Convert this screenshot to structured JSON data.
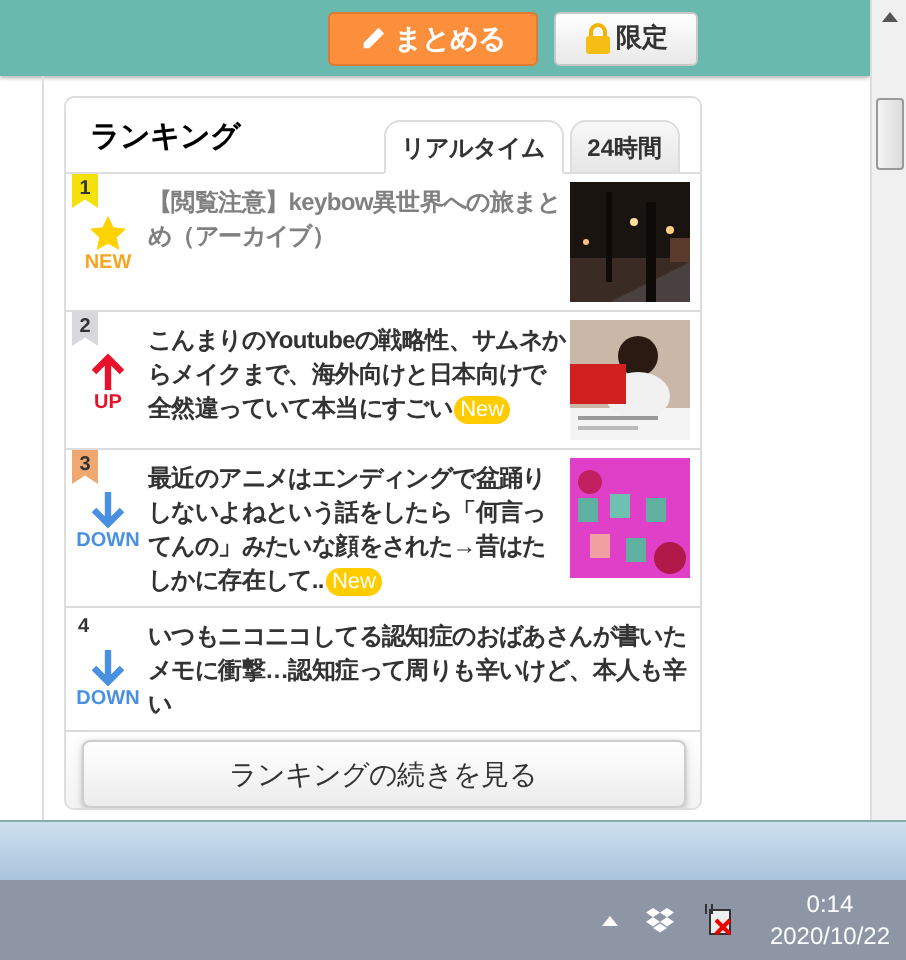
{
  "header": {
    "buttons": [
      {
        "kind": "primary",
        "label": "まとめる"
      },
      {
        "kind": "locked",
        "label": "限定"
      }
    ]
  },
  "ranking": {
    "title": "ランキング",
    "tabs": [
      {
        "label": "リアルタイム",
        "selected": true
      },
      {
        "label": "24時間",
        "selected": false
      }
    ],
    "items": [
      {
        "rank": "1",
        "color": "#f5e10a",
        "kind": "new",
        "trend_label": "NEW",
        "title": "【閲覧注意】keybow異世界への旅まとめ（アーカイブ）",
        "visited": true,
        "new": false
      },
      {
        "rank": "2",
        "color": "#d8d8dc",
        "kind": "up",
        "trend_label": "UP",
        "title": "こんまりのYoutubeの戦略性、サムネからメイクまで、海外向けと日本向けで全然違っていて本当にすごい",
        "visited": false,
        "new": true,
        "new_label": "New"
      },
      {
        "rank": "3",
        "color": "#f0a870",
        "kind": "down",
        "trend_label": "DOWN",
        "title": "最近のアニメはエンディングで盆踊りしないよねという話をしたら「何言ってんの」みたいな顔をされた→昔はたしかに存在して..",
        "visited": false,
        "new": true,
        "new_label": "New"
      },
      {
        "rank": "4",
        "kind": "down",
        "trend_label": "DOWN",
        "title": "いつもニコニコしてる認知症のおばあさんが書いたメモに衝撃…認知症って周りも辛いけど、本人も辛い",
        "visited": false,
        "new": false
      }
    ],
    "more_button": "ランキングの続きを見る"
  },
  "taskbar": {
    "time": "0:14",
    "date": "2020/10/22"
  }
}
